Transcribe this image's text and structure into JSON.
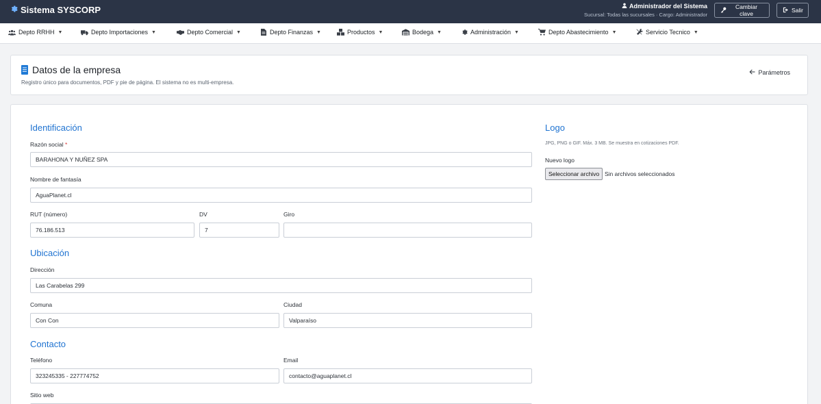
{
  "topbar": {
    "brand": "Sistema SYSCORP",
    "user_name": "Administrador del Sistema",
    "user_sub": "Sucursal: Todas las sucursales · Cargo: Administrador",
    "change_pass_label": "Cambiar clave",
    "logout_label": "Salir",
    "colors": {
      "background": "#2b3446",
      "brand_icon": "#6fb1ff"
    }
  },
  "nav": {
    "items": [
      {
        "label": "Depto RRHH",
        "icon": "users-icon"
      },
      {
        "label": "Depto Importaciones",
        "icon": "truck-icon"
      },
      {
        "label": "Depto Comercial",
        "icon": "handshake-icon"
      },
      {
        "label": "Depto Finanzas",
        "icon": "document-icon"
      },
      {
        "label": "Productos",
        "icon": "boxes-icon"
      },
      {
        "label": "Bodega",
        "icon": "warehouse-icon"
      },
      {
        "label": "Administración",
        "icon": "gear-icon"
      },
      {
        "label": "Depto Abastecimiento",
        "icon": "cart-icon"
      },
      {
        "label": "Servicio Tecnico",
        "icon": "tools-icon"
      }
    ]
  },
  "header": {
    "title": "Datos de la empresa",
    "subtitle": "Registro único para documentos, PDF y pie de página. El sistema no es multi-empresa.",
    "back_link": "Parámetros",
    "accent": "#1f7ad6"
  },
  "form": {
    "identificacion": {
      "title": "Identificación",
      "razon_social_label": "Razón social",
      "required_mark": "*",
      "razon_social_value": "BARAHONA Y NUÑEZ SPA",
      "fantasia_label": "Nombre de fantasía",
      "fantasia_value": "AguaPlanet.cl",
      "rut_label": "RUT (número)",
      "rut_value": "76.186.513",
      "dv_label": "DV",
      "dv_value": "7",
      "giro_label": "Giro",
      "giro_value": ""
    },
    "ubicacion": {
      "title": "Ubicación",
      "direccion_label": "Dirección",
      "direccion_value": "Las Carabelas 299",
      "comuna_label": "Comuna",
      "comuna_value": "Con Con",
      "ciudad_label": "Ciudad",
      "ciudad_value": "Valparaíso"
    },
    "contacto": {
      "title": "Contacto",
      "telefono_label": "Teléfono",
      "telefono_value": "323245335 - 227774752",
      "email_label": "Email",
      "email_value": "contacto@aguaplanet.cl",
      "sitio_label": "Sitio web"
    },
    "logo": {
      "title": "Logo",
      "hint": "JPG, PNG o GIF. Máx. 3 MB. Se muestra en cotizaciones PDF.",
      "new_logo_label": "Nuevo logo",
      "file_button": "Seleccionar archivo",
      "file_status": "Sin archivos seleccionados"
    },
    "section_color": "#1f73d1"
  }
}
